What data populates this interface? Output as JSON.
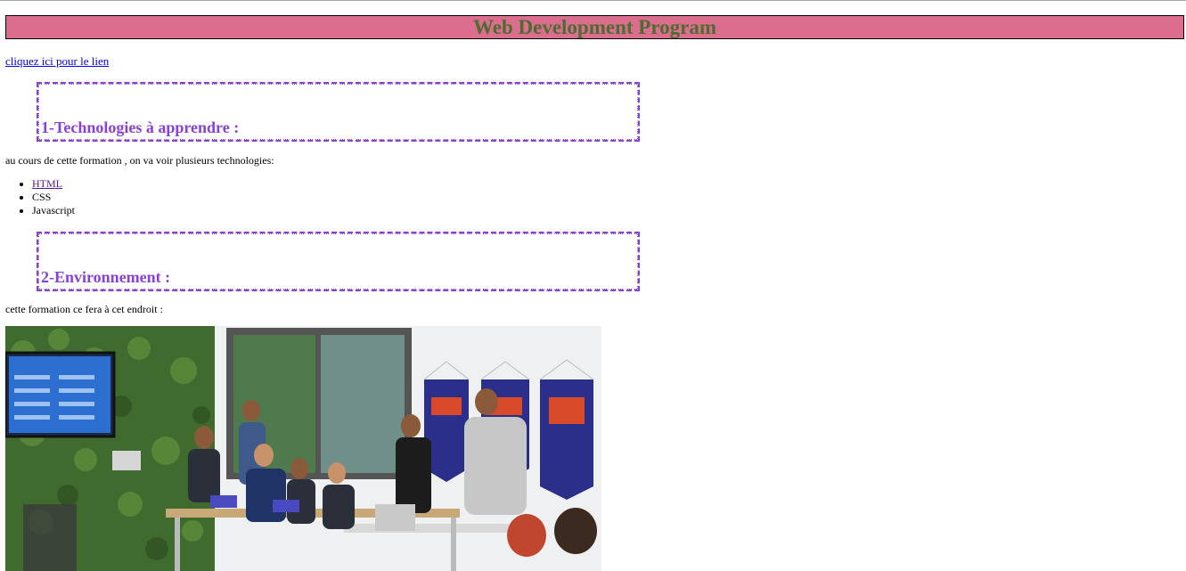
{
  "header": {
    "title": "Web Development Program"
  },
  "links": {
    "top_link": "cliquez ici pour le lien "
  },
  "sections": [
    {
      "title": "1-Technologies à apprendre :"
    },
    {
      "title": "2-Environnement :"
    }
  ],
  "paragraphs": {
    "intro": "au cours de cette formation , on va voir plusieurs technologies:",
    "env": "cette formation ce fera à cet endroit :"
  },
  "technologies": [
    "HTML",
    "CSS",
    "Javascript"
  ],
  "colors": {
    "title_bar_bg": "#db6e8f",
    "title_text": "#4e6b30",
    "section_accent": "#8a3fd6",
    "link": "#0000ee",
    "visited_link": "#551a8b"
  },
  "image": {
    "semantic": "photo of a classroom with students at laptops, green wall, screen and banners"
  }
}
